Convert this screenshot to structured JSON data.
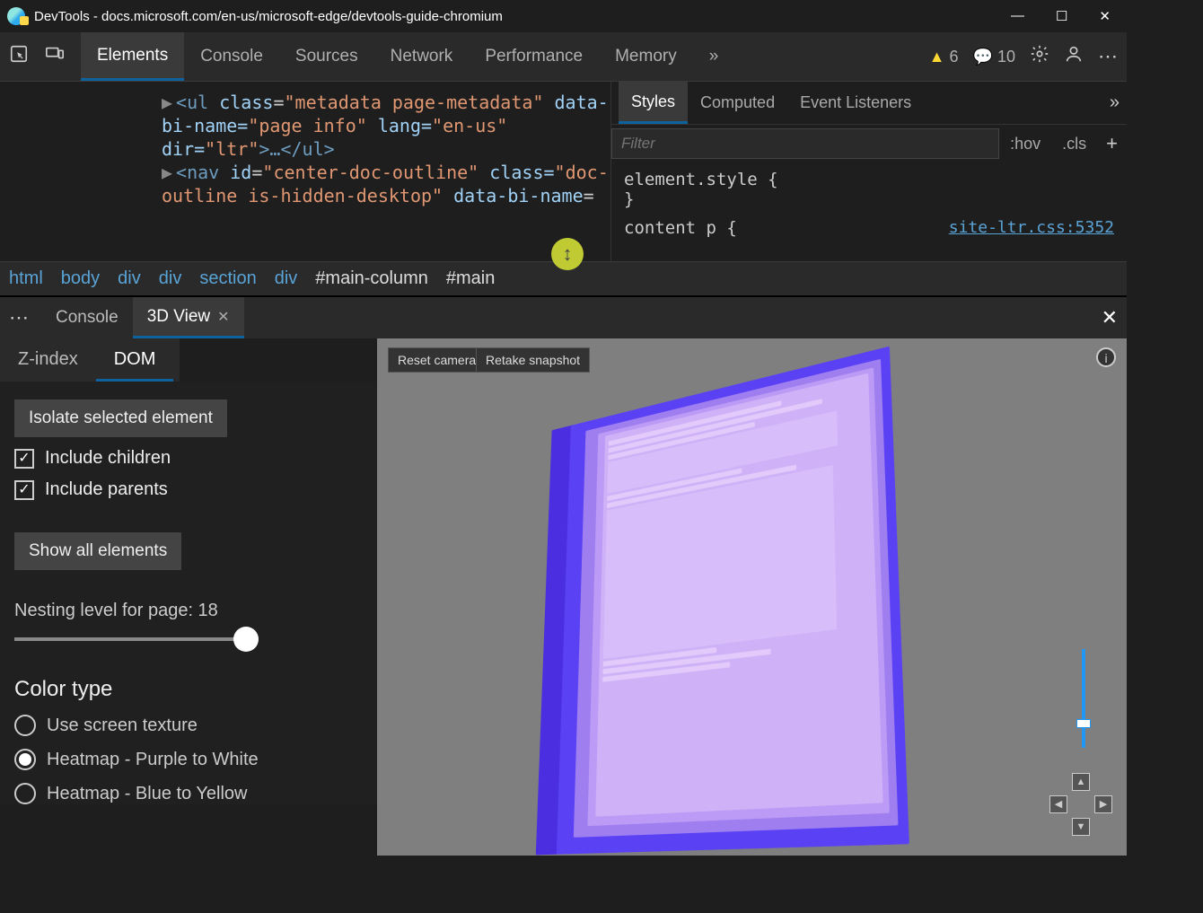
{
  "window": {
    "title": "DevTools - docs.microsoft.com/en-us/microsoft-edge/devtools-guide-chromium"
  },
  "toolbar": {
    "tabs": [
      "Elements",
      "Console",
      "Sources",
      "Network",
      "Performance",
      "Memory"
    ],
    "warnings": "6",
    "messages": "10"
  },
  "code": {
    "line1a": "<ul ",
    "line1_class": "class",
    "line1_classval": "\"metadata page-metadata\"",
    "line1b": " data-bi-name=",
    "line1_bival": "\"page info\"",
    "line1c": " lang=",
    "line1_langval": "\"en-us\"",
    "line1d": " dir=",
    "line1_dirval": "\"ltr\"",
    "line1e": ">…</ul>",
    "line2a": "<nav ",
    "line2_id": "id",
    "line2_idval": "\"center-doc-outline\"",
    "line2b": " class=",
    "line2_classval": "\"doc-outline is-hidden-desktop\"",
    "line2c": " data-bi-name",
    "line2d": "="
  },
  "styles": {
    "tabs": [
      "Styles",
      "Computed",
      "Event Listeners"
    ],
    "filter_placeholder": "Filter",
    "hov": ":hov",
    "cls": ".cls",
    "rule1": "element.style {",
    "rule1b": "}",
    "rule2": "content p {",
    "css_link": "site-ltr.css:5352"
  },
  "breadcrumb": [
    "html",
    "body",
    "div",
    "div",
    "section",
    "div",
    "#main-column",
    "#main"
  ],
  "drawer": {
    "tabs": [
      "Console",
      "3D View"
    ],
    "side_tabs": [
      "Z-index",
      "DOM"
    ],
    "isolate": "Isolate selected element",
    "include_children": "Include children",
    "include_parents": "Include parents",
    "show_all": "Show all elements",
    "nesting": "Nesting level for page: 18",
    "color_type": "Color type",
    "radio1": "Use screen texture",
    "radio2": "Heatmap - Purple to White",
    "radio3": "Heatmap - Blue to Yellow",
    "reset": "Reset camera",
    "retake": "Retake snapshot"
  }
}
